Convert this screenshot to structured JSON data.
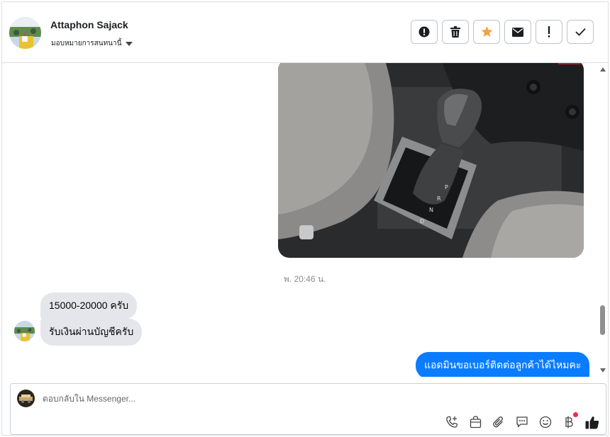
{
  "header": {
    "contact_name": "Attaphon Sajack",
    "assign_label": "มอบหมายการสนทนานี้",
    "actions": [
      {
        "name": "report-spam-button",
        "icon": "alert-circle-icon"
      },
      {
        "name": "delete-button",
        "icon": "trash-icon"
      },
      {
        "name": "star-button",
        "icon": "star-icon"
      },
      {
        "name": "mark-unread-button",
        "icon": "envelope-icon"
      },
      {
        "name": "follow-up-button",
        "icon": "exclamation-icon"
      },
      {
        "name": "mark-done-button",
        "icon": "check-icon"
      }
    ]
  },
  "messages": {
    "timestamp": "พ. 20:46 น.",
    "incoming": [
      "15000-20000 ครับ",
      "รับเงินผ่านบัญชีครับ"
    ],
    "outgoing": [
      "แอดมินขอเบอร์ติดต่อลูกค้าได้ไหมคะ"
    ]
  },
  "composer": {
    "placeholder": "ตอบกลับใน Messenger...",
    "tools": [
      "call-icon",
      "shop-bag-icon",
      "attachment-icon",
      "saved-reply-icon",
      "emoji-icon",
      "baht-payment-icon",
      "like-icon"
    ]
  },
  "colors": {
    "accent_blue": "#0a7cff",
    "incoming_bubble": "#e4e6eb",
    "star_orange": "#f5a142",
    "notification_red": "#f02849"
  }
}
